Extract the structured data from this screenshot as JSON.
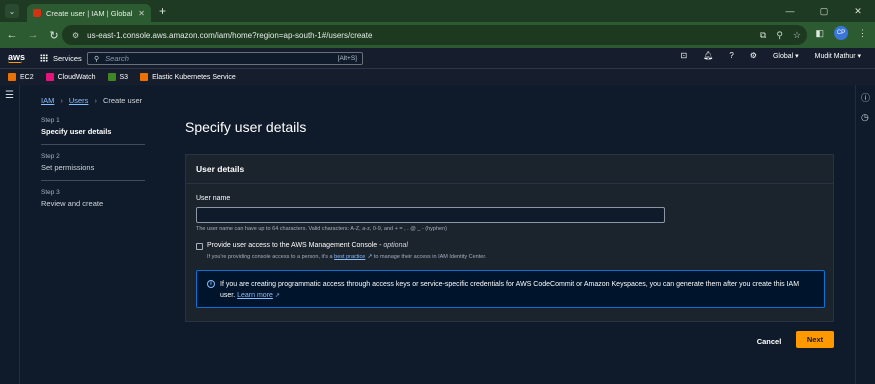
{
  "browser": {
    "tab_title": "Create user | IAM | Global",
    "tab_close": "✕",
    "new_tab": "+",
    "url": "us-east-1.console.aws.amazon.com/iam/home?region=ap-south-1#/users/create",
    "profile_initials": "CP",
    "window_controls": [
      "—",
      "▢",
      "✕"
    ]
  },
  "aws_header": {
    "logo": "aws",
    "services_label": "Services",
    "search_placeholder": "Search",
    "search_shortcut": "[Alt+S]",
    "region": "Global",
    "region_caret": "▾",
    "user": "Mudit Mathur",
    "user_caret": "▾"
  },
  "favorites": [
    {
      "label": "EC2",
      "color": "#ed7100"
    },
    {
      "label": "CloudWatch",
      "color": "#e7157b"
    },
    {
      "label": "S3",
      "color": "#3f8624"
    },
    {
      "label": "Elastic Kubernetes Service",
      "color": "#ed7100"
    }
  ],
  "breadcrumb": {
    "iam": "IAM",
    "users": "Users",
    "current": "Create user",
    "separator": "›"
  },
  "steps": [
    {
      "num": "Step 1",
      "label": "Specify user details"
    },
    {
      "num": "Step 2",
      "label": "Set permissions"
    },
    {
      "num": "Step 3",
      "label": "Review and create"
    }
  ],
  "page_title": "Specify user details",
  "user_details": {
    "heading": "User details",
    "username_label": "User name",
    "username_value": "",
    "username_help": "The user name can have up to 64 characters. Valid characters: A-Z, a-z, 0-9, and + = , . @ _ - (hyphen)",
    "console_access_label": "Provide user access to the AWS Management Console - ",
    "console_access_optional": "optional",
    "console_desc_pre": "If you're providing console access to a person, it's a ",
    "console_desc_link": "best practice",
    "console_desc_post": " to manage their access in IAM Identity Center.",
    "info_text": "If you are creating programmatic access through access keys or service-specific credentials for AWS CodeCommit or Amazon Keyspaces, you can generate them after you create this IAM user. ",
    "info_link": "Learn more"
  },
  "actions": {
    "cancel": "Cancel",
    "next": "Next"
  },
  "colors": {
    "accent": "#ff9900",
    "link": "#89bdff",
    "info_border": "#0972d3"
  }
}
